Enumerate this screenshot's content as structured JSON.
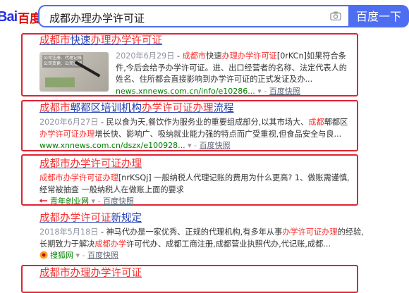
{
  "header": {
    "logo_du": "Bai",
    "logo_text": "百度",
    "search_value": "成都办理办学许可证",
    "search_button": "百度一下",
    "camera_icon": "camera-icon"
  },
  "results": [
    {
      "title_parts": [
        "成都市",
        "快速",
        "办理办学许可证"
      ],
      "date": "2020年6月29日",
      "abstract_1": " - ",
      "abstract_em": "成都市",
      "abstract_2": "快速",
      "abstract_em2": "办理办学许可证",
      "abstract_3": "[0rKCn]如果符合条件,今后会给予办学许可证。进、出口经营者的名称、法定代表人的姓名、住所都会直接影响到办学许可证的正式发证及办...",
      "url": "news.xnnews.com.cn/info/e10286...",
      "snapshot": "百度快照",
      "thumb_text": "公司注册、代理记账\n公司变更、公司注销"
    },
    {
      "title_parts": [
        "成都市",
        "郫都区培训机构",
        "办学许可证办理",
        "流程"
      ],
      "date": "2020年6月27日",
      "abstract_1": " - 民以食为天,餐饮作为服务业的重要组成部分,以其市场大、",
      "abstract_em": "成都",
      "abstract_2": "郫都区",
      "abstract_em2": "办学许可证办理",
      "abstract_3": "增长快、影响广、吸纳就业能力强的特点而广受重视,但食品安全与良...",
      "url": "www.xnnews.com.cn/dszx/e100928...",
      "snapshot": "百度快照"
    },
    {
      "title_parts": [
        "成都市",
        "办学许可证办理"
      ],
      "abstract_em": "成都市办学许可证办理",
      "abstract_1": "[nrKSQj] 一般纳税人代理记账的费用为什么更高? 1、做账需谨慎,经常被抽查 一般纳税人在做账上面的要求",
      "source": "青年创业网",
      "snapshot": "百度快照"
    },
    {
      "title_parts": [
        "成都办学许可证",
        "新规定"
      ],
      "date": "2018年5月18日",
      "abstract_1": " - 神马代办是一家优秀、正规的代理机构,有多年从事",
      "abstract_em": "办学许可证办理",
      "abstract_2": "的经验,长期致力于解决",
      "abstract_em2": "成都办学",
      "abstract_3": "许可代办、成都工商注册,成都营业执照代办,代记账,成都...",
      "source": "搜狐网",
      "snapshot": "百度快照"
    },
    {
      "title_parts": [
        "成都市",
        "办理办学许可证"
      ]
    }
  ]
}
